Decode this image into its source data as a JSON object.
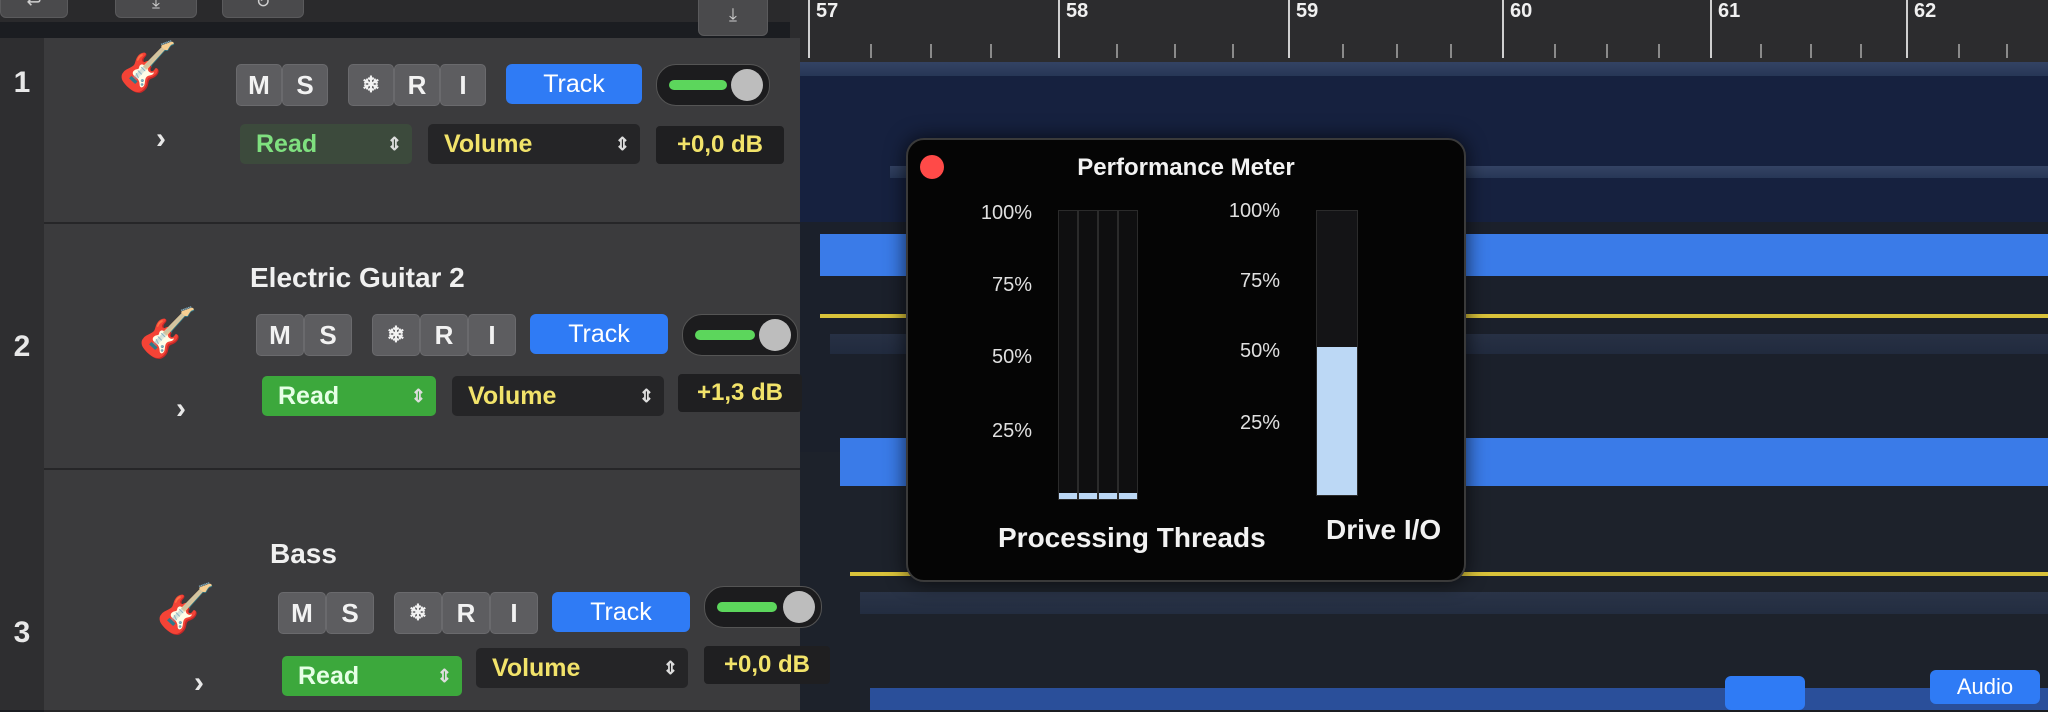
{
  "toolbar": {
    "buttons": [
      {
        "icon": "arrow-icon"
      },
      {
        "icon": "download-icon"
      },
      {
        "icon": "loop-icon"
      },
      {
        "icon": "download-icon"
      }
    ]
  },
  "ruler": {
    "bars": [
      "57",
      "58",
      "59",
      "60",
      "61",
      "62"
    ]
  },
  "tracks": [
    {
      "number": "1",
      "name": "",
      "icon": "electric-guitar-red-icon",
      "buttons": {
        "mute": "M",
        "solo": "S",
        "freeze": "❄",
        "record": "R",
        "input": "I",
        "track": "Track"
      },
      "automation_mode": "Read",
      "automation_param": "Volume",
      "value": "+0,0 dB"
    },
    {
      "number": "2",
      "name": "Electric Guitar 2",
      "icon": "electric-guitar-sunburst-icon",
      "buttons": {
        "mute": "M",
        "solo": "S",
        "freeze": "❄",
        "record": "R",
        "input": "I",
        "track": "Track"
      },
      "automation_mode": "Read",
      "automation_param": "Volume",
      "value": "+1,3 dB"
    },
    {
      "number": "3",
      "name": "Bass",
      "icon": "bass-guitar-icon",
      "buttons": {
        "mute": "M",
        "solo": "S",
        "freeze": "❄",
        "record": "R",
        "input": "I",
        "track": "Track"
      },
      "automation_mode": "Read",
      "automation_param": "Volume",
      "value": "+0,0 dB"
    }
  ],
  "performance_meter": {
    "title": "Performance Meter",
    "scale": [
      "100%",
      "75%",
      "50%",
      "25%"
    ],
    "processing_threads_label": "Processing Threads",
    "drive_io_label": "Drive I/O",
    "thread_levels": [
      0.02,
      0.02,
      0.02,
      0.02
    ],
    "drive_io_level": 0.52,
    "colors": {
      "fill": "#bcd8f5",
      "close": "#ff4a48"
    }
  },
  "bottom_bar": {
    "audio_label": "Audio"
  },
  "colors": {
    "accent": "#2f7bf5",
    "read_green": "#3ca83c",
    "automation_yellow": "#d9c23a",
    "region_blue": "#3a7be8"
  }
}
